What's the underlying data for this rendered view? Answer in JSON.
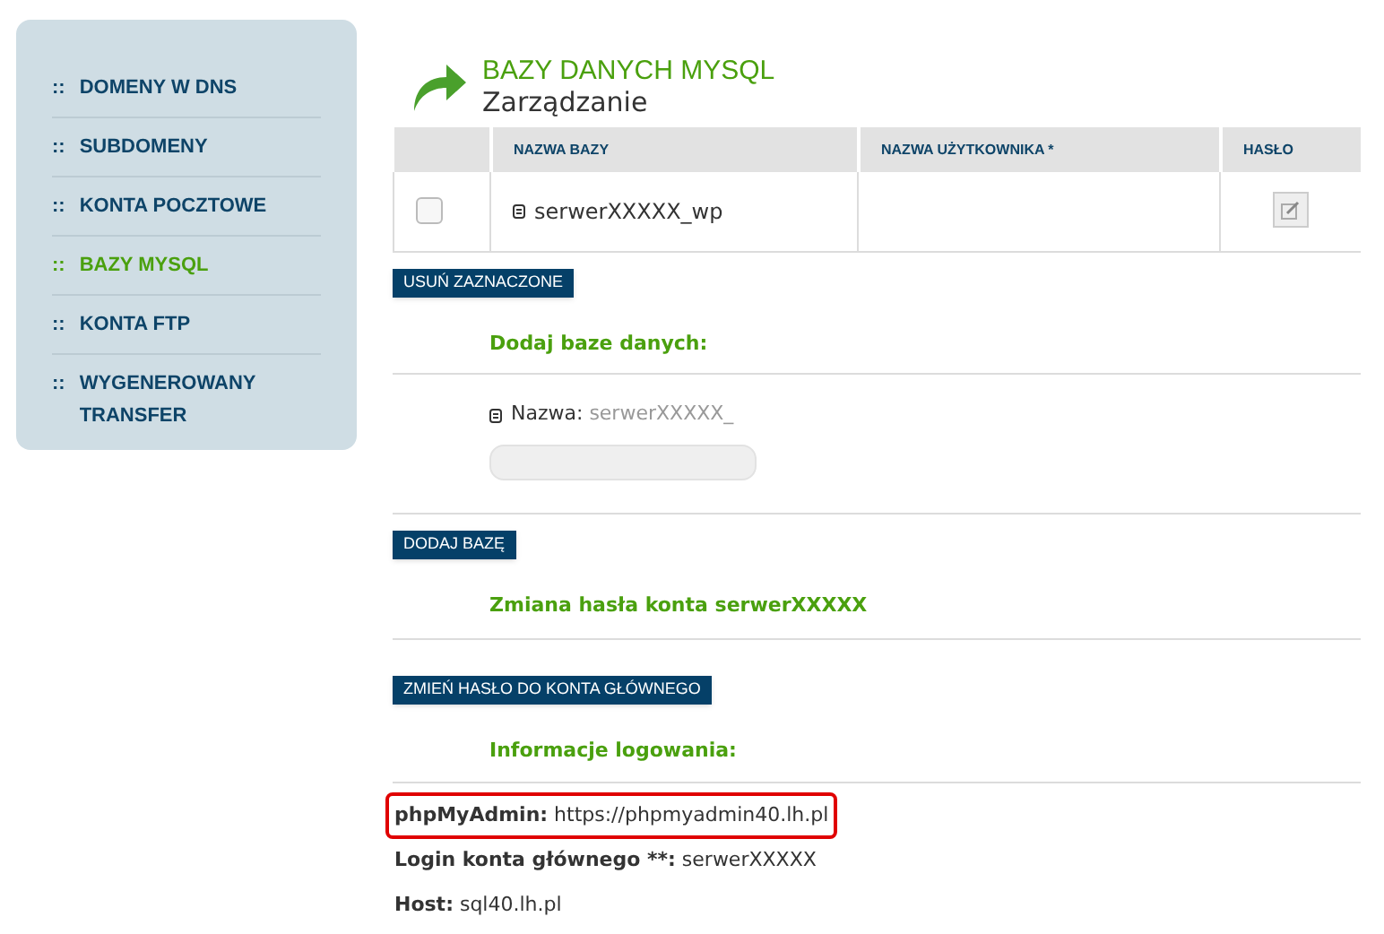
{
  "sidebar": {
    "items": [
      {
        "label": "DOMENY W DNS",
        "selected": false
      },
      {
        "label": "SUBDOMENY",
        "selected": false
      },
      {
        "label": "KONTA POCZTOWE",
        "selected": false
      },
      {
        "label": "BAZY MYSQL",
        "selected": true
      },
      {
        "label": "KONTA FTP",
        "selected": false
      },
      {
        "label": "WYGENEROWANY TRANSFER",
        "selected": false
      }
    ],
    "bullet": "::"
  },
  "header": {
    "title": "BAZY DANYCH MYSQL",
    "subtitle": "Zarządzanie"
  },
  "table": {
    "columns": [
      "NAZWA BAZY",
      "NAZWA UŻYTKOWNIKA *",
      "HASŁO"
    ],
    "rows": [
      {
        "checked": false,
        "name": "serwerXXXXX_wp"
      }
    ]
  },
  "delete_button": "USUŃ ZAZNACZONE",
  "add_section": {
    "heading": "Dodaj baze danych:",
    "label": "Nazwa:",
    "prefix": "serwerXXXXX_",
    "button": "DODAJ BAZĘ"
  },
  "password_section": {
    "heading": "Zmiana hasła konta serwerXXXXX",
    "button": "ZMIEŃ HASŁO DO KONTA GŁÓWNEGO"
  },
  "login_section": {
    "heading": "Informacje logowania:",
    "items": [
      {
        "label": "phpMyAdmin:",
        "value": "https://phpmyadmin40.lh.pl",
        "highlighted": true
      },
      {
        "label": "Login konta głównego **:",
        "value": "serwerXXXXX",
        "highlighted": false
      },
      {
        "label": "Host:",
        "value": "sql40.lh.pl",
        "highlighted": false
      }
    ]
  }
}
